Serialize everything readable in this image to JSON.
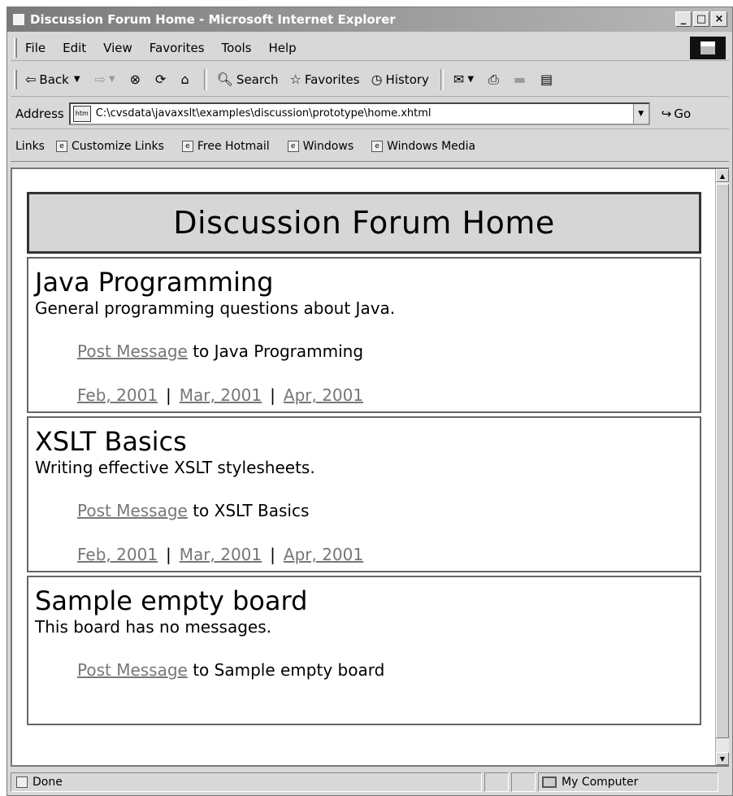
{
  "window": {
    "title": "Discussion Forum Home - Microsoft Internet Explorer",
    "minimize": "_",
    "maximize": "□",
    "close": "×"
  },
  "menu": {
    "items": [
      "File",
      "Edit",
      "View",
      "Favorites",
      "Tools",
      "Help"
    ]
  },
  "toolbar": {
    "back": "Back",
    "search": "Search",
    "favorites": "Favorites",
    "history": "History"
  },
  "address": {
    "label": "Address",
    "icon_text": "htm",
    "url": "C:\\cvsdata\\javaxslt\\examples\\discussion\\prototype\\home.xhtml",
    "go": "Go"
  },
  "links": {
    "label": "Links",
    "items": [
      "Customize Links",
      "Free Hotmail",
      "Windows",
      "Windows Media"
    ]
  },
  "page": {
    "heading": "Discussion Forum Home",
    "boards": [
      {
        "title": "Java Programming",
        "description": "General programming questions about Java.",
        "post_link": "Post Message",
        "post_suffix": "to Java Programming",
        "archives": [
          "Feb, 2001",
          "Mar, 2001",
          "Apr, 2001"
        ]
      },
      {
        "title": "XSLT Basics",
        "description": "Writing effective XSLT stylesheets.",
        "post_link": "Post Message",
        "post_suffix": "to XSLT Basics",
        "archives": [
          "Feb, 2001",
          "Mar, 2001",
          "Apr, 2001"
        ]
      },
      {
        "title": "Sample empty board",
        "description": "This board has no messages.",
        "post_link": "Post Message",
        "post_suffix": "to Sample empty board",
        "archives": []
      }
    ],
    "archive_separator": "|"
  },
  "status": {
    "text": "Done",
    "zone": "My Computer"
  }
}
